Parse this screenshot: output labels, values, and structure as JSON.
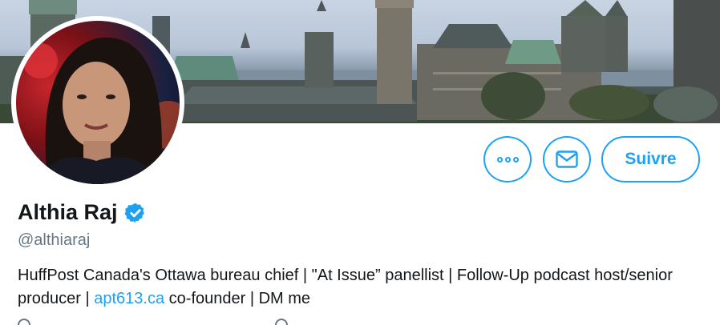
{
  "profile": {
    "name": "Althia Raj",
    "handle": "@althiaraj",
    "verified": true,
    "bio_part1": "HuffPost Canada's Ottawa bureau chief | \"At Issue” panellist | Follow-Up podcast host/senior producer | ",
    "bio_link": "apt613.ca",
    "bio_part2": " co-founder | DM me"
  },
  "actions": {
    "more_icon": "more-options-icon",
    "message_icon": "envelope-icon",
    "follow_label": "Suivre"
  },
  "colors": {
    "accent": "#1da1f2",
    "text": "#14171a",
    "secondary_text": "#657786"
  }
}
